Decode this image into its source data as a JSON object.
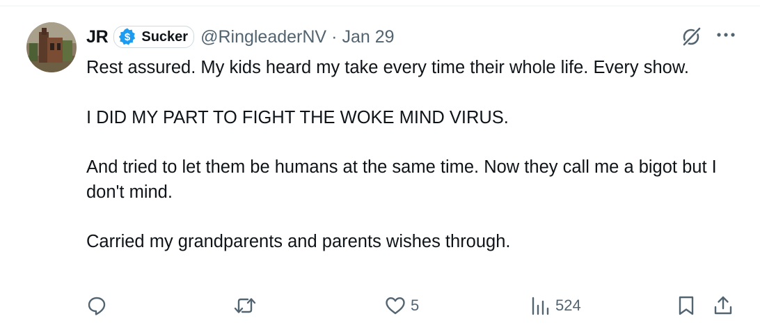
{
  "author": {
    "name": "JR",
    "badge_label": "Sucker",
    "handle": "@RingleaderNV",
    "separator": "·",
    "date": "Jan 29"
  },
  "tweet": {
    "paragraphs": [
      "Rest assured.  My kids heard my take every time their whole life.  Every show.",
      "I DID MY PART TO FIGHT THE WOKE MIND VIRUS.",
      "And tried to let them be humans at the same time.  Now they call me a bigot but I don't mind.",
      "Carried my grandparents and parents wishes through."
    ]
  },
  "actions": {
    "reply_count": "",
    "retweet_count": "",
    "like_count": "5",
    "views_count": "524"
  },
  "icons": {
    "badge": "dollar-badge-icon",
    "grok": "grok-icon",
    "more": "more-icon",
    "reply": "reply-icon",
    "retweet": "retweet-icon",
    "like": "heart-icon",
    "views": "views-icon",
    "bookmark": "bookmark-icon",
    "share": "share-icon"
  },
  "colors": {
    "text": "#0f1419",
    "secondary": "#536471",
    "badge": "#1d9bf0"
  }
}
